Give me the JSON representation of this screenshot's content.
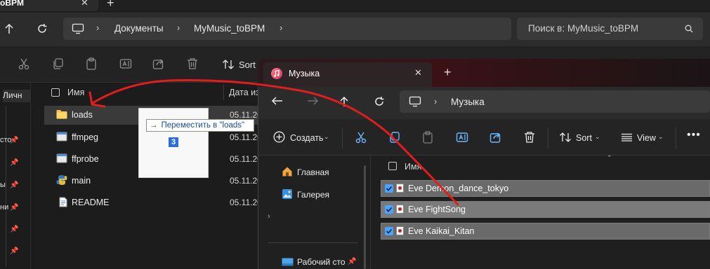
{
  "back_window": {
    "tab_title": "oBPM",
    "breadcrumb": [
      "Документы",
      "MyMusic_toBPM"
    ],
    "search_placeholder": "Поиск в: MyMusic_toBPM",
    "toolbar": {
      "sort_label": "Sort"
    },
    "nav_strip": {
      "selected": "Личн",
      "items": [
        "сто",
        "ы",
        "ни"
      ]
    },
    "columns": {
      "name": "Имя",
      "date": "Дата из"
    },
    "files": [
      {
        "name": "loads",
        "date": "05.11.20",
        "icon": "folder-icon"
      },
      {
        "name": "ffmpeg",
        "date": "05.11.20",
        "icon": "executable-icon"
      },
      {
        "name": "ffprobe",
        "date": "05.11.20",
        "icon": "executable-icon"
      },
      {
        "name": "main",
        "date": "05.11.20",
        "icon": "python-file-icon"
      },
      {
        "name": "README",
        "date": "05.11.20",
        "icon": "document-icon"
      }
    ]
  },
  "drag": {
    "arrow": "→",
    "label": "Переместить в \"loads\"",
    "count": "3"
  },
  "front_window": {
    "tab_title": "Музыка",
    "breadcrumb": "Музыка",
    "toolbar": {
      "create_label": "Создать",
      "sort_label": "Sort",
      "view_label": "View",
      "more_label": "•••"
    },
    "nav": {
      "home": "Главная",
      "gallery": "Галерея",
      "desktop": "Рабочий сто"
    },
    "list_header": "Имя",
    "files": [
      {
        "name": "Eve Demon_dance_tokyo",
        "selected": true
      },
      {
        "name": "Eve FightSong",
        "selected": true
      },
      {
        "name": "Eve Kaikai_Kitan",
        "selected": true
      }
    ]
  },
  "colors": {
    "accent": "#4aa3ff",
    "annotation": "#e01e1e",
    "drag_count_bg": "#2c6fd6"
  }
}
